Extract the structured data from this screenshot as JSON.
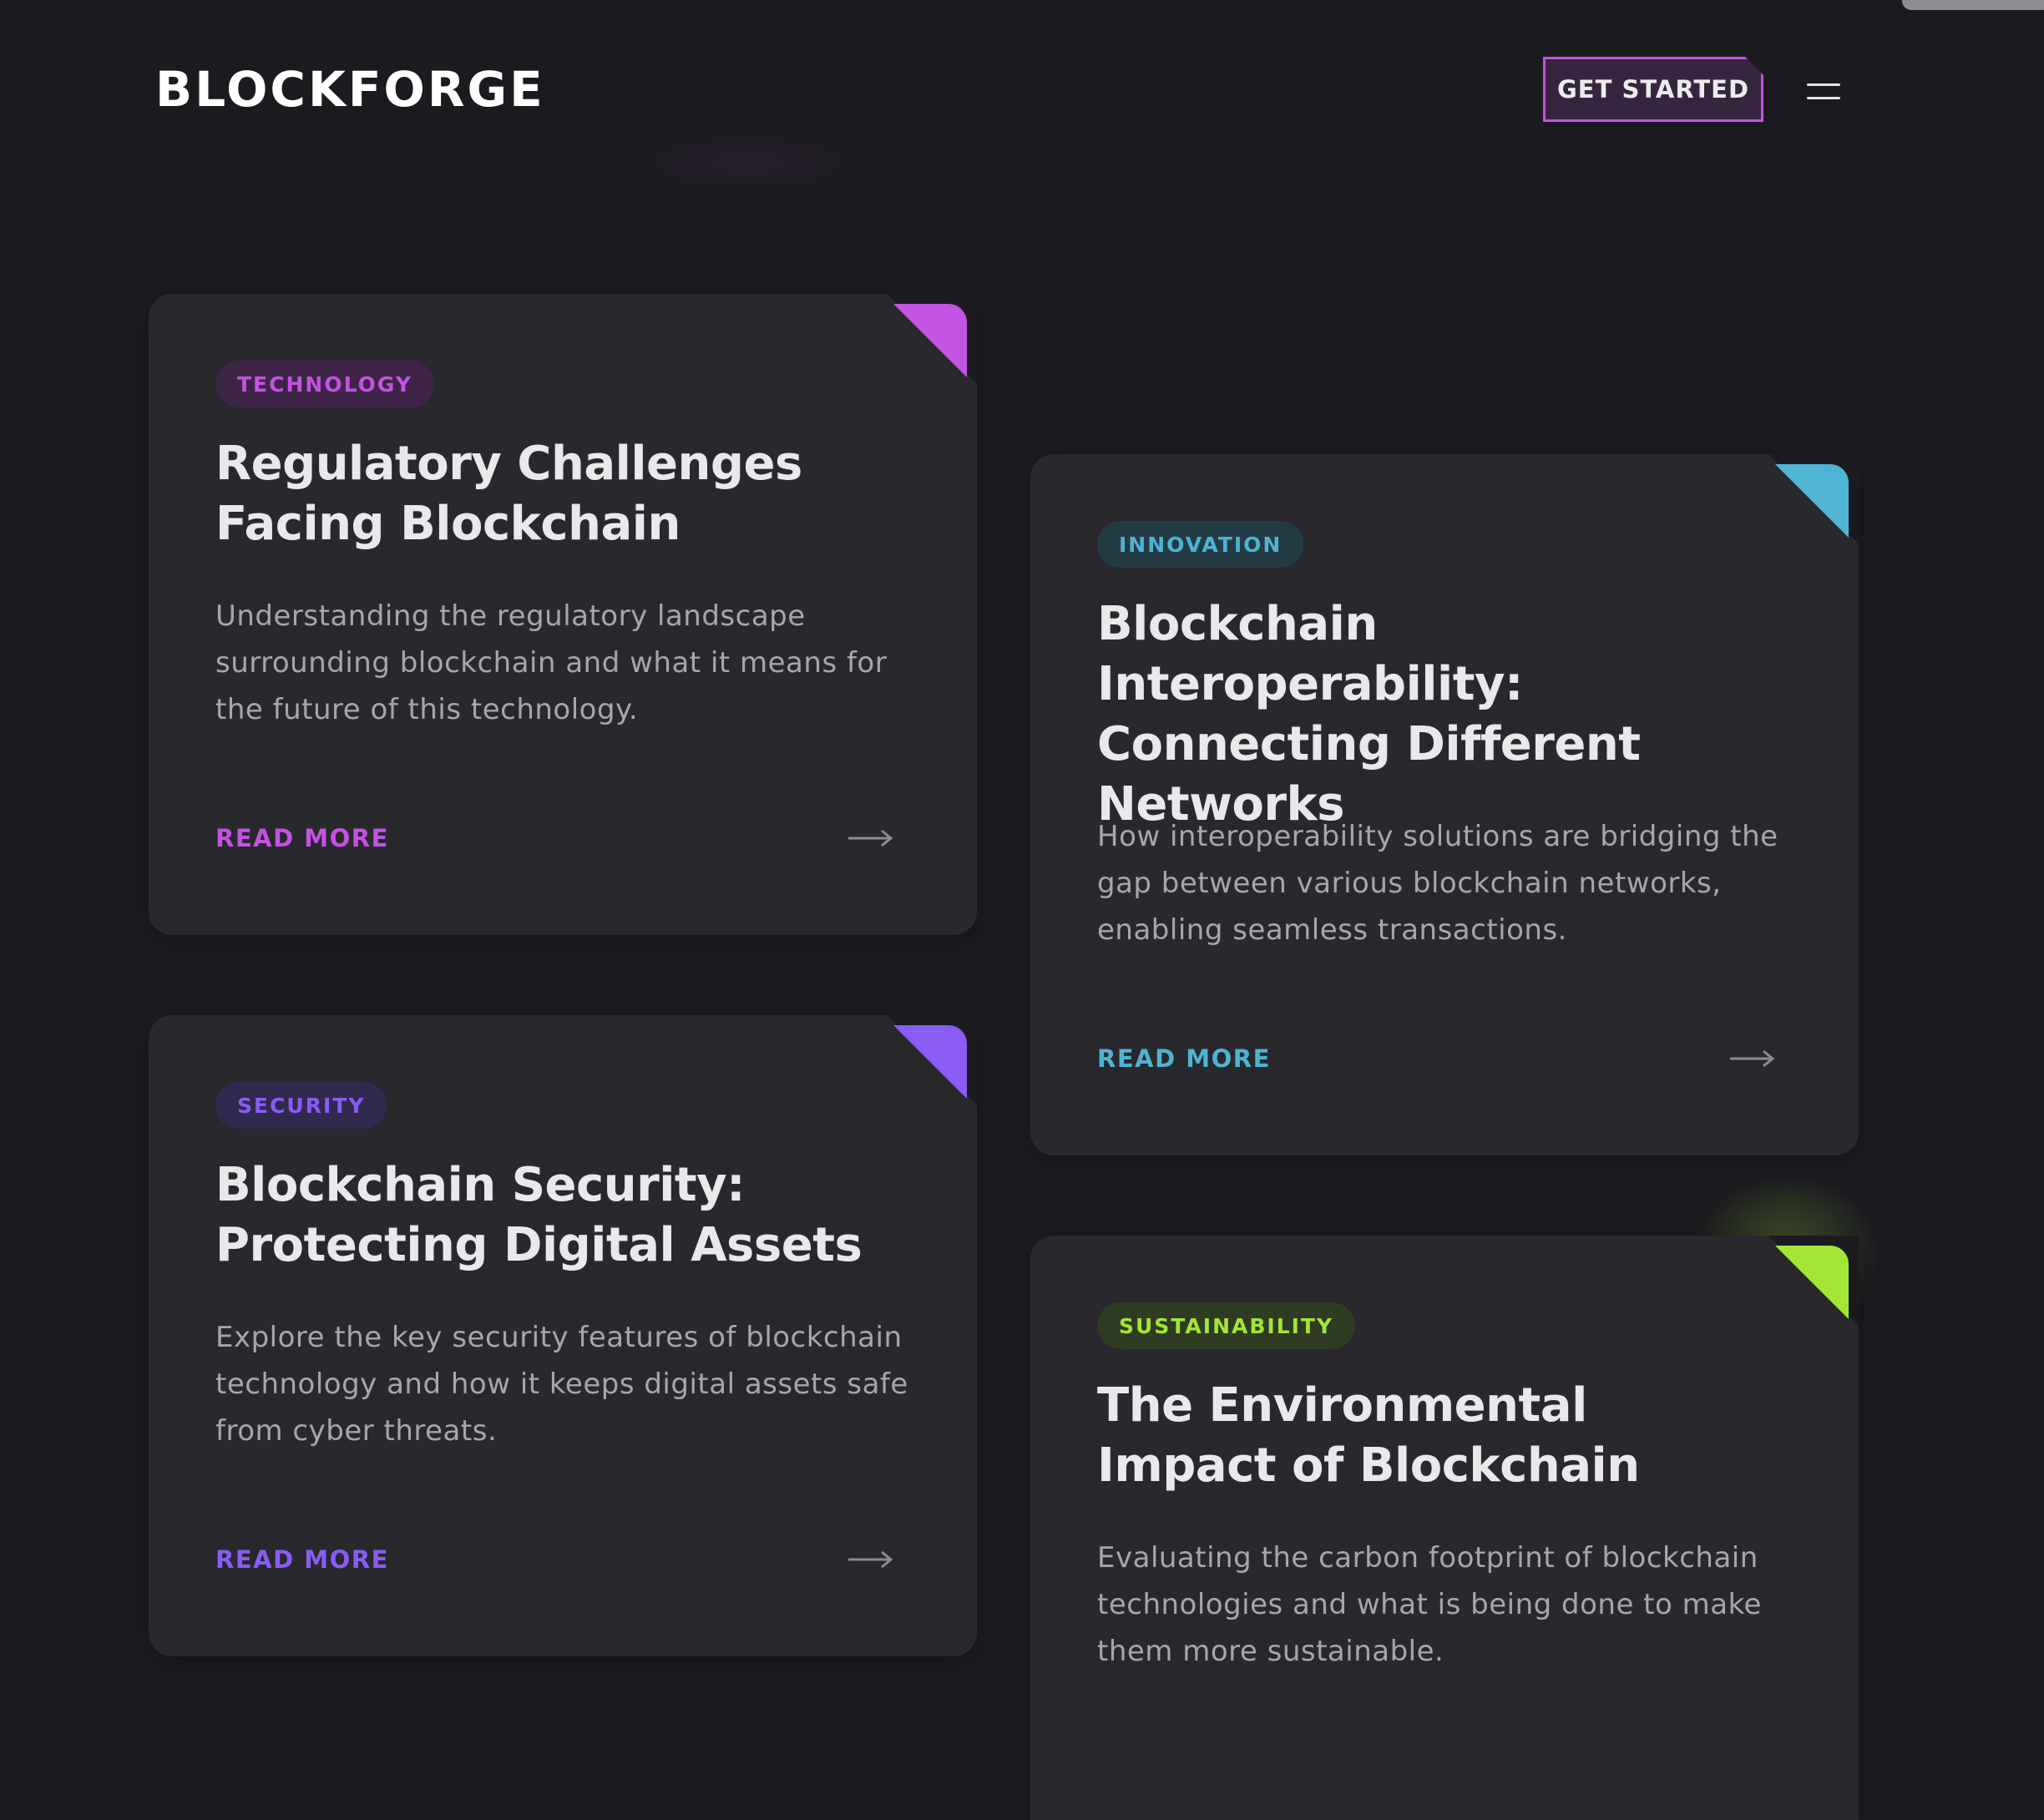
{
  "header": {
    "logo": "BLOCKFORGE",
    "cta_label": "GET STARTED",
    "menu_icon": "hamburger-icon"
  },
  "colors": {
    "background": "#1b1b1f",
    "card": "#28282d",
    "technology": "#c452e2",
    "innovation": "#4fb3d3",
    "security": "#8a5cf6",
    "sustainability": "#a3e635"
  },
  "cards": [
    {
      "tag": "TECHNOLOGY",
      "title": "Regulatory Challenges Facing Blockchain",
      "description": "Understanding the regulatory landscape surrounding blockchain and what it means for the future of this technology.",
      "link": "READ MORE",
      "arrow_icon": "arrow-right-icon"
    },
    {
      "tag": "INNOVATION",
      "title": "Blockchain Interoperability: Connecting Different Networks",
      "description": "How interoperability solutions are bridging the gap between various blockchain networks, enabling seamless transactions.",
      "link": "READ MORE",
      "arrow_icon": "arrow-right-icon"
    },
    {
      "tag": "SECURITY",
      "title": "Blockchain Security: Protecting Digital Assets",
      "description": "Explore the key security features of blockchain technology and how it keeps digital assets safe from cyber threats.",
      "link": "READ MORE",
      "arrow_icon": "arrow-right-icon"
    },
    {
      "tag": "SUSTAINABILITY",
      "title": "The Environmental Impact of Blockchain",
      "description": "Evaluating the carbon footprint of blockchain technologies and what is being done to make them more sustainable."
    }
  ]
}
